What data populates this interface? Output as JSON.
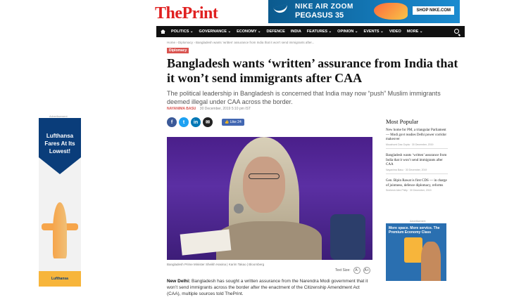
{
  "header": {
    "logo_the": "The",
    "logo_print": "Print",
    "top_ad": {
      "line1": "NIKE AIR ZOOM",
      "line2": "PEGASUS 35",
      "shop": "SHOP NIKE.COM"
    }
  },
  "nav": {
    "items": [
      {
        "label": "POLITICS ⌄"
      },
      {
        "label": "GOVERNANCE ⌄"
      },
      {
        "label": "ECONOMY ⌄"
      },
      {
        "label": "DEFENCE"
      },
      {
        "label": "INDIA"
      },
      {
        "label": "FEATURES ⌄"
      },
      {
        "label": "OPINION ⌄"
      },
      {
        "label": "EVENTS ⌄"
      },
      {
        "label": "VIDEO"
      },
      {
        "label": "MORE ⌄"
      }
    ]
  },
  "article": {
    "breadcrumb": "Home › Diplomacy › Bangladesh wants ‘written’ assurance from India that it won’t send immigrants after...",
    "tag": "Diplomacy",
    "headline": "Bangladesh wants ‘written’ assurance from India that it won’t send immigrants after CAA",
    "subtitle": "The political leadership in Bangladesh is concerned that India may now “push” Muslim immigrants deemed illegal under CAA across the border.",
    "author": "Nayanima Basu",
    "date": "30 December, 2019 5:10 pm IST",
    "like_label": "👍 Like 24",
    "caption": "Bangladesh Prime Minister Sheikh Hasina | Karim Takao | Bloomberg",
    "text_size_label": "Text Size:",
    "text_size_minus": "A-",
    "text_size_plus": "A+",
    "body_lead": "New Delhi:",
    "body_text": " Bangladesh has sought a written assurance from the Narendra Modi government that it won’t send immigrants across the border after the enactment of the Citizenship Amendment Act (CAA), multiple sources told ThePrint."
  },
  "left_ad": {
    "label": "Advertisement",
    "text": "Lufthansa Fares At Its Lowest!",
    "brand": "Lufthansa"
  },
  "sidebar": {
    "title": "Most Popular",
    "items": [
      {
        "title": "New home for PM, a triangular Parliament — Modi govt readies Delhi power corridor makeover",
        "meta": "Moushumi Das Gupta · 30 December, 2019"
      },
      {
        "title": "Bangladesh wants ‘written’ assurance from India that it won’t send immigrants after CAA",
        "meta": "Nayanima Basu · 30 December, 2019"
      },
      {
        "title": "Gen. Bipin Rawat is first CDS — in charge of jointness, defence diplomacy, reforms",
        "meta": "Snehesh Alex Philip · 30 December, 2019"
      }
    ],
    "ad_label": "Advertisement",
    "ad_text": "More space. More service. The Premium Economy Class"
  },
  "colors": {
    "brand_red": "#e02020",
    "nav_bg": "#111111",
    "tag_bg": "#d9534f"
  }
}
